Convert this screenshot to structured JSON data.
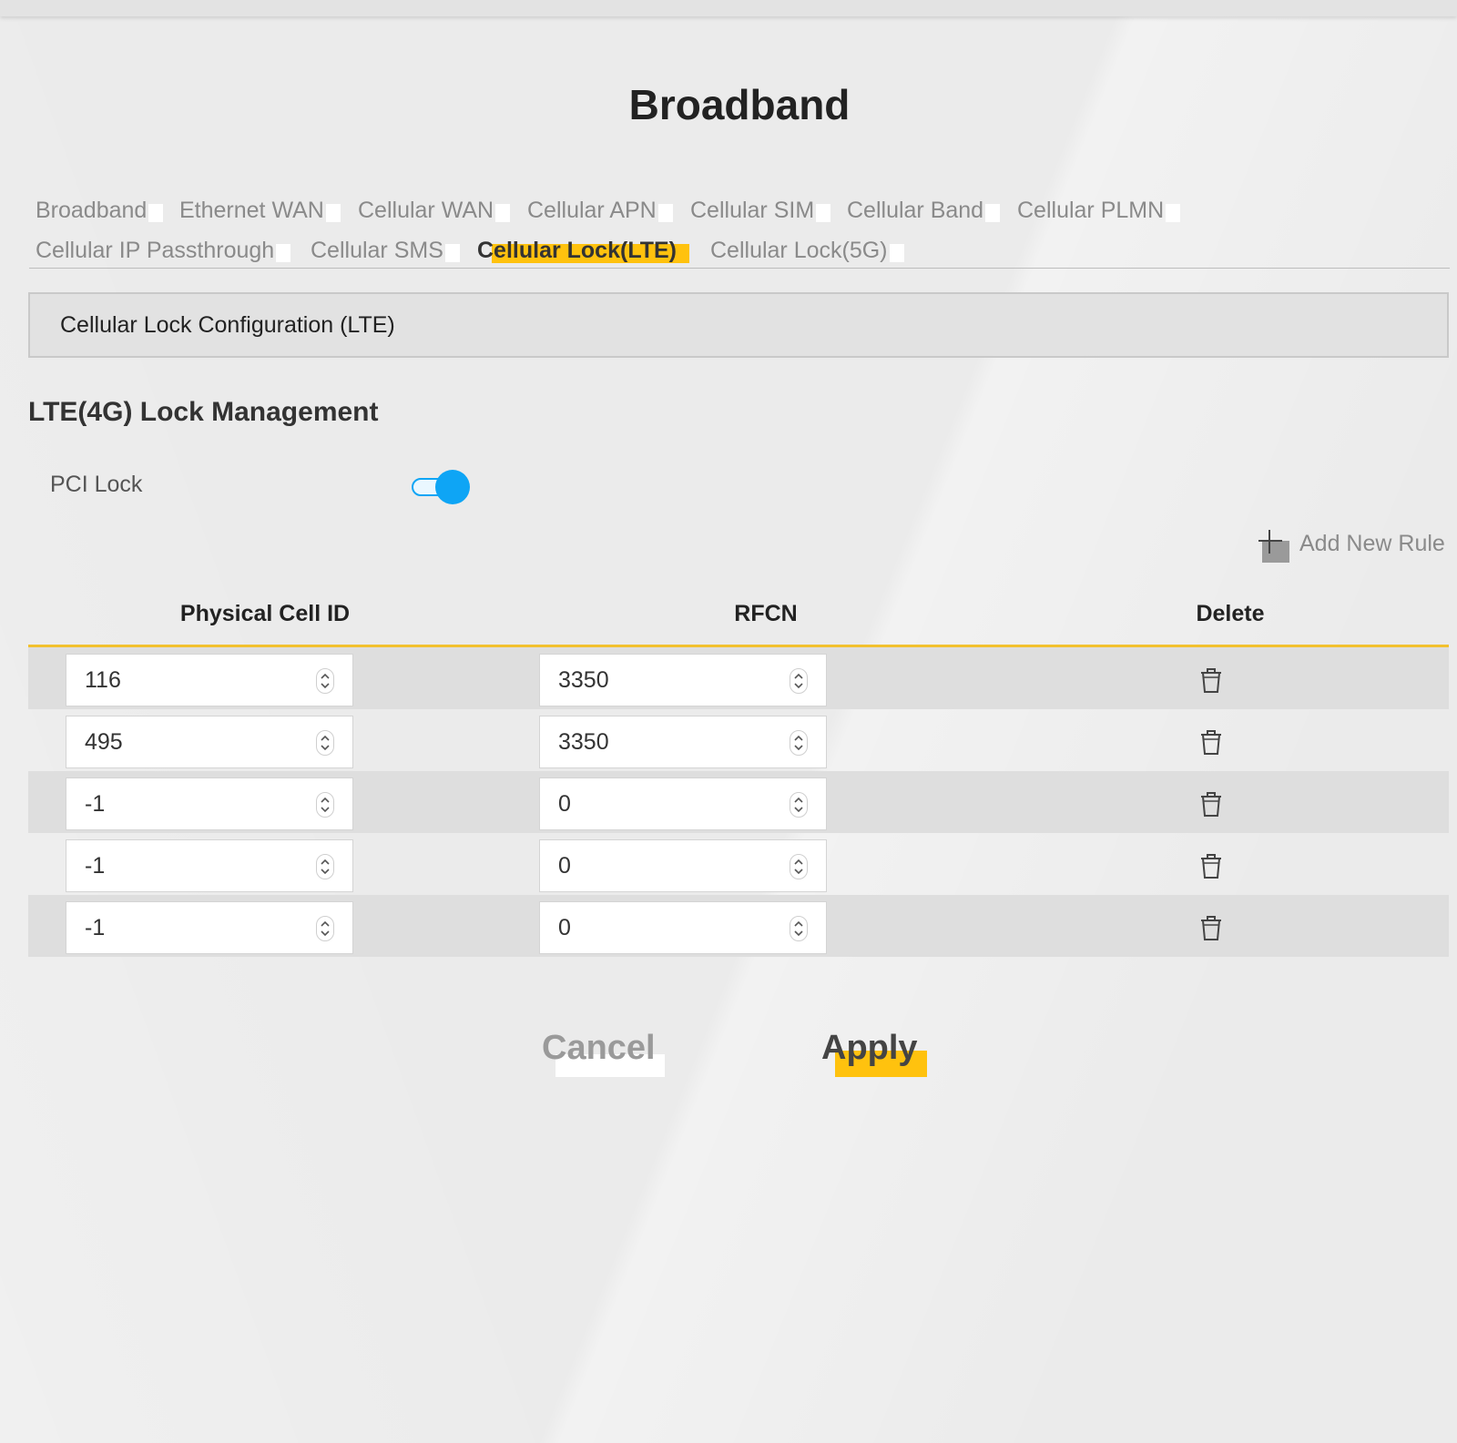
{
  "page": {
    "title": "Broadband"
  },
  "tabs": [
    {
      "label": "Broadband",
      "active": false
    },
    {
      "label": "Ethernet WAN",
      "active": false
    },
    {
      "label": "Cellular WAN",
      "active": false
    },
    {
      "label": "Cellular APN",
      "active": false
    },
    {
      "label": "Cellular SIM",
      "active": false
    },
    {
      "label": "Cellular Band",
      "active": false
    },
    {
      "label": "Cellular PLMN",
      "active": false
    },
    {
      "label": "Cellular IP Passthrough",
      "active": false
    },
    {
      "label": "Cellular SMS",
      "active": false
    },
    {
      "label": "Cellular Lock(LTE)",
      "active": true
    },
    {
      "label": "Cellular Lock(5G)",
      "active": false
    }
  ],
  "section": {
    "header": "Cellular Lock Configuration (LTE)",
    "title": "LTE(4G) Lock Management"
  },
  "pci_lock": {
    "label": "PCI Lock",
    "enabled": true
  },
  "add_rule": {
    "label": "Add New Rule"
  },
  "table": {
    "headers": {
      "pci": "Physical Cell ID",
      "rfcn": "RFCN",
      "delete": "Delete"
    },
    "rows": [
      {
        "pci": "116",
        "rfcn": "3350"
      },
      {
        "pci": "495",
        "rfcn": "3350"
      },
      {
        "pci": "-1",
        "rfcn": "0"
      },
      {
        "pci": "-1",
        "rfcn": "0"
      },
      {
        "pci": "-1",
        "rfcn": "0"
      }
    ]
  },
  "actions": {
    "cancel": "Cancel",
    "apply": "Apply"
  },
  "colors": {
    "accent": "#ffc20e",
    "toggle": "#0ea5f5",
    "table_rule": "#f2c12e"
  }
}
